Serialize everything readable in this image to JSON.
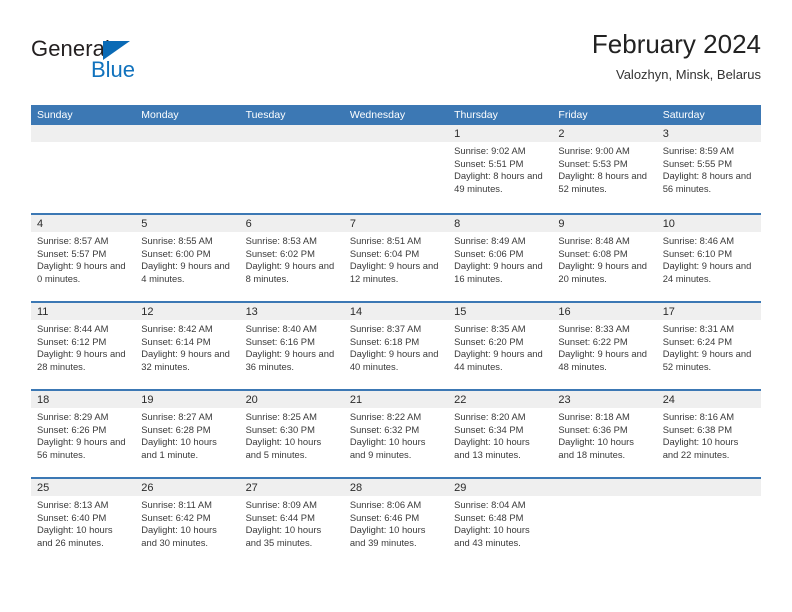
{
  "brand": {
    "name_part1": "General",
    "name_part2": "Blue",
    "triangle_color": "#0a6ab5",
    "blue_color": "#1072bd"
  },
  "header": {
    "title": "February 2024",
    "subtitle": "Valozhyn, Minsk, Belarus"
  },
  "theme": {
    "header_band": "#3c78b4",
    "day_band": "#efefef",
    "row_rule": "#3c78b4"
  },
  "calendar": {
    "weekdays": [
      "Sunday",
      "Monday",
      "Tuesday",
      "Wednesday",
      "Thursday",
      "Friday",
      "Saturday"
    ],
    "weeks": [
      [
        {
          "day": "",
          "empty": true
        },
        {
          "day": "",
          "empty": true
        },
        {
          "day": "",
          "empty": true
        },
        {
          "day": "",
          "empty": true
        },
        {
          "day": "1",
          "sunrise": "Sunrise: 9:02 AM",
          "sunset": "Sunset: 5:51 PM",
          "daylight": "Daylight: 8 hours and 49 minutes."
        },
        {
          "day": "2",
          "sunrise": "Sunrise: 9:00 AM",
          "sunset": "Sunset: 5:53 PM",
          "daylight": "Daylight: 8 hours and 52 minutes."
        },
        {
          "day": "3",
          "sunrise": "Sunrise: 8:59 AM",
          "sunset": "Sunset: 5:55 PM",
          "daylight": "Daylight: 8 hours and 56 minutes."
        }
      ],
      [
        {
          "day": "4",
          "sunrise": "Sunrise: 8:57 AM",
          "sunset": "Sunset: 5:57 PM",
          "daylight": "Daylight: 9 hours and 0 minutes."
        },
        {
          "day": "5",
          "sunrise": "Sunrise: 8:55 AM",
          "sunset": "Sunset: 6:00 PM",
          "daylight": "Daylight: 9 hours and 4 minutes."
        },
        {
          "day": "6",
          "sunrise": "Sunrise: 8:53 AM",
          "sunset": "Sunset: 6:02 PM",
          "daylight": "Daylight: 9 hours and 8 minutes."
        },
        {
          "day": "7",
          "sunrise": "Sunrise: 8:51 AM",
          "sunset": "Sunset: 6:04 PM",
          "daylight": "Daylight: 9 hours and 12 minutes."
        },
        {
          "day": "8",
          "sunrise": "Sunrise: 8:49 AM",
          "sunset": "Sunset: 6:06 PM",
          "daylight": "Daylight: 9 hours and 16 minutes."
        },
        {
          "day": "9",
          "sunrise": "Sunrise: 8:48 AM",
          "sunset": "Sunset: 6:08 PM",
          "daylight": "Daylight: 9 hours and 20 minutes."
        },
        {
          "day": "10",
          "sunrise": "Sunrise: 8:46 AM",
          "sunset": "Sunset: 6:10 PM",
          "daylight": "Daylight: 9 hours and 24 minutes."
        }
      ],
      [
        {
          "day": "11",
          "sunrise": "Sunrise: 8:44 AM",
          "sunset": "Sunset: 6:12 PM",
          "daylight": "Daylight: 9 hours and 28 minutes."
        },
        {
          "day": "12",
          "sunrise": "Sunrise: 8:42 AM",
          "sunset": "Sunset: 6:14 PM",
          "daylight": "Daylight: 9 hours and 32 minutes."
        },
        {
          "day": "13",
          "sunrise": "Sunrise: 8:40 AM",
          "sunset": "Sunset: 6:16 PM",
          "daylight": "Daylight: 9 hours and 36 minutes."
        },
        {
          "day": "14",
          "sunrise": "Sunrise: 8:37 AM",
          "sunset": "Sunset: 6:18 PM",
          "daylight": "Daylight: 9 hours and 40 minutes."
        },
        {
          "day": "15",
          "sunrise": "Sunrise: 8:35 AM",
          "sunset": "Sunset: 6:20 PM",
          "daylight": "Daylight: 9 hours and 44 minutes."
        },
        {
          "day": "16",
          "sunrise": "Sunrise: 8:33 AM",
          "sunset": "Sunset: 6:22 PM",
          "daylight": "Daylight: 9 hours and 48 minutes."
        },
        {
          "day": "17",
          "sunrise": "Sunrise: 8:31 AM",
          "sunset": "Sunset: 6:24 PM",
          "daylight": "Daylight: 9 hours and 52 minutes."
        }
      ],
      [
        {
          "day": "18",
          "sunrise": "Sunrise: 8:29 AM",
          "sunset": "Sunset: 6:26 PM",
          "daylight": "Daylight: 9 hours and 56 minutes."
        },
        {
          "day": "19",
          "sunrise": "Sunrise: 8:27 AM",
          "sunset": "Sunset: 6:28 PM",
          "daylight": "Daylight: 10 hours and 1 minute."
        },
        {
          "day": "20",
          "sunrise": "Sunrise: 8:25 AM",
          "sunset": "Sunset: 6:30 PM",
          "daylight": "Daylight: 10 hours and 5 minutes."
        },
        {
          "day": "21",
          "sunrise": "Sunrise: 8:22 AM",
          "sunset": "Sunset: 6:32 PM",
          "daylight": "Daylight: 10 hours and 9 minutes."
        },
        {
          "day": "22",
          "sunrise": "Sunrise: 8:20 AM",
          "sunset": "Sunset: 6:34 PM",
          "daylight": "Daylight: 10 hours and 13 minutes."
        },
        {
          "day": "23",
          "sunrise": "Sunrise: 8:18 AM",
          "sunset": "Sunset: 6:36 PM",
          "daylight": "Daylight: 10 hours and 18 minutes."
        },
        {
          "day": "24",
          "sunrise": "Sunrise: 8:16 AM",
          "sunset": "Sunset: 6:38 PM",
          "daylight": "Daylight: 10 hours and 22 minutes."
        }
      ],
      [
        {
          "day": "25",
          "sunrise": "Sunrise: 8:13 AM",
          "sunset": "Sunset: 6:40 PM",
          "daylight": "Daylight: 10 hours and 26 minutes."
        },
        {
          "day": "26",
          "sunrise": "Sunrise: 8:11 AM",
          "sunset": "Sunset: 6:42 PM",
          "daylight": "Daylight: 10 hours and 30 minutes."
        },
        {
          "day": "27",
          "sunrise": "Sunrise: 8:09 AM",
          "sunset": "Sunset: 6:44 PM",
          "daylight": "Daylight: 10 hours and 35 minutes."
        },
        {
          "day": "28",
          "sunrise": "Sunrise: 8:06 AM",
          "sunset": "Sunset: 6:46 PM",
          "daylight": "Daylight: 10 hours and 39 minutes."
        },
        {
          "day": "29",
          "sunrise": "Sunrise: 8:04 AM",
          "sunset": "Sunset: 6:48 PM",
          "daylight": "Daylight: 10 hours and 43 minutes."
        },
        {
          "day": "",
          "empty": true
        },
        {
          "day": "",
          "empty": true
        }
      ]
    ]
  }
}
